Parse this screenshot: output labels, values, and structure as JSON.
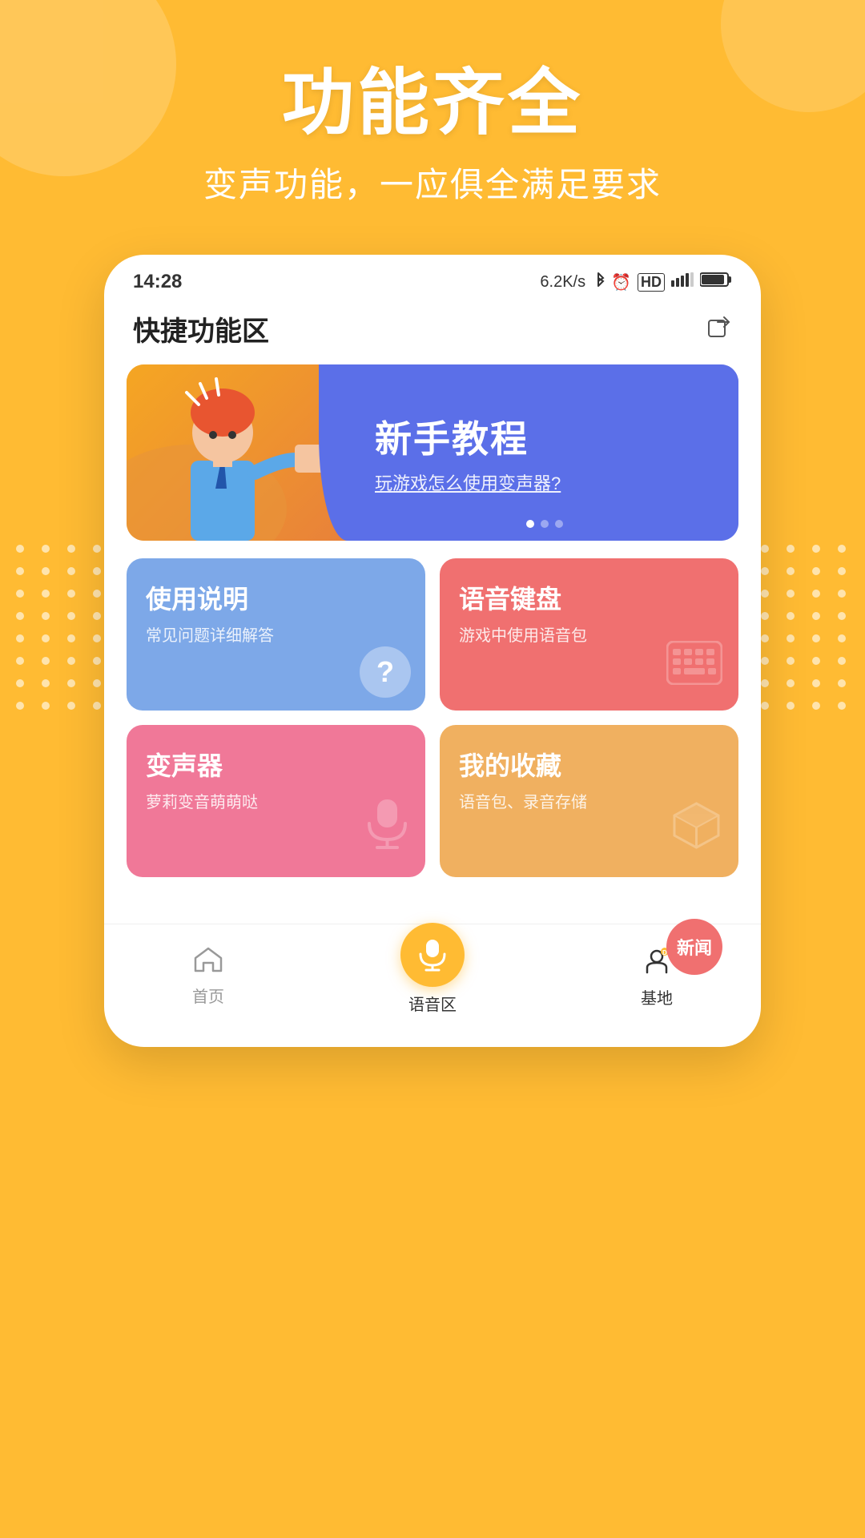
{
  "background_color": "#FFBB33",
  "hero": {
    "title": "功能齐全",
    "subtitle": "变声功能，一应俱全满足要求"
  },
  "status_bar": {
    "time": "14:28",
    "network_speed": "6.2K/s",
    "battery": "▬",
    "icons": "🔵 ⏰ HD 4G"
  },
  "header": {
    "title": "快捷功能区",
    "share_icon": "⬡"
  },
  "banner": {
    "title": "新手教程",
    "subtitle": "玩游戏怎么使用变声器?",
    "bg_color_left": "#F5A623",
    "bg_color_right": "#5B6FE8"
  },
  "cards": [
    {
      "id": "usage",
      "title": "使用说明",
      "subtitle": "常见问题详细解答",
      "color": "#7DA8E8",
      "icon_type": "question"
    },
    {
      "id": "voice-keyboard",
      "title": "语音键盘",
      "subtitle": "游戏中使用语音包",
      "color": "#F07070",
      "icon_type": "keyboard"
    },
    {
      "id": "voice-changer",
      "title": "变声器",
      "subtitle": "萝莉变音萌萌哒",
      "color": "#F07898",
      "icon_type": "microphone"
    },
    {
      "id": "favorites",
      "title": "我的收藏",
      "subtitle": "语音包、录音存储",
      "color": "#F0B060",
      "icon_type": "box"
    }
  ],
  "news_badge": {
    "label": "新闻"
  },
  "bottom_nav": [
    {
      "id": "home",
      "label": "首页",
      "icon": "home",
      "active": false
    },
    {
      "id": "voice-zone",
      "label": "语音区",
      "icon": "mic",
      "active": false,
      "center": true
    },
    {
      "id": "base",
      "label": "基地",
      "icon": "base",
      "active": true
    }
  ],
  "dots": {
    "rows": 8,
    "cols": 4
  }
}
